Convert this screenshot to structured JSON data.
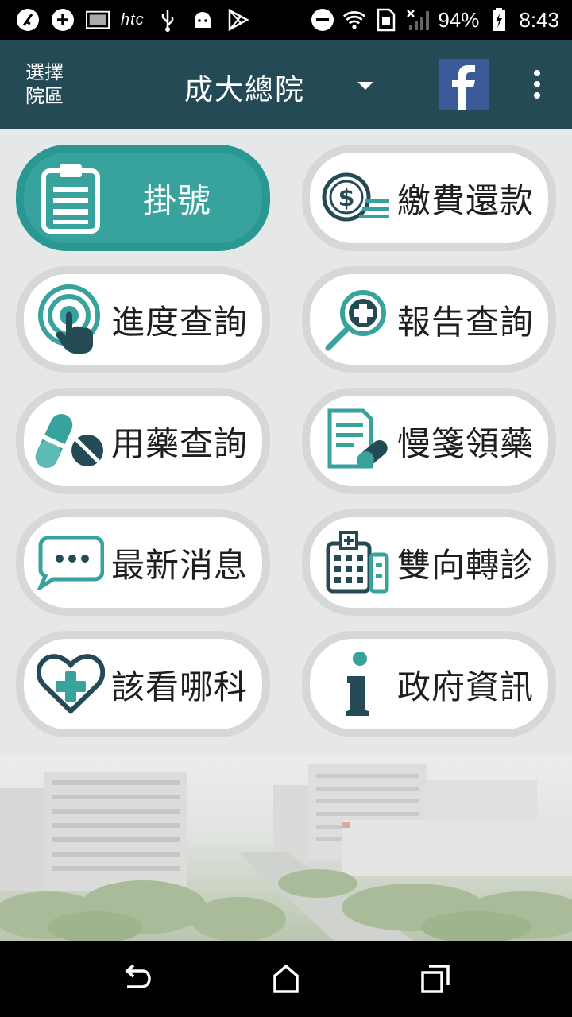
{
  "status_bar": {
    "battery": "94%",
    "time": "8:43",
    "carrier": "htc"
  },
  "header": {
    "select_label": "選擇\n院區",
    "hospital": "成大總院"
  },
  "menu": [
    {
      "label": "掛號",
      "icon": "clipboard-icon",
      "active": true
    },
    {
      "label": "繳費還款",
      "icon": "payment-icon"
    },
    {
      "label": "進度查詢",
      "icon": "touch-icon"
    },
    {
      "label": "報告查詢",
      "icon": "magnifier-plus-icon"
    },
    {
      "label": "用藥查詢",
      "icon": "pill-icon"
    },
    {
      "label": "慢箋領藥",
      "icon": "prescription-icon"
    },
    {
      "label": "最新消息",
      "icon": "chat-icon"
    },
    {
      "label": "雙向轉診",
      "icon": "hospital-icon"
    },
    {
      "label": "該看哪科",
      "icon": "heart-cross-icon"
    },
    {
      "label": "政府資訊",
      "icon": "info-icon"
    }
  ],
  "colors": {
    "appbar": "#234a55",
    "teal": "#38a29c",
    "dark_icon": "#234a55"
  }
}
